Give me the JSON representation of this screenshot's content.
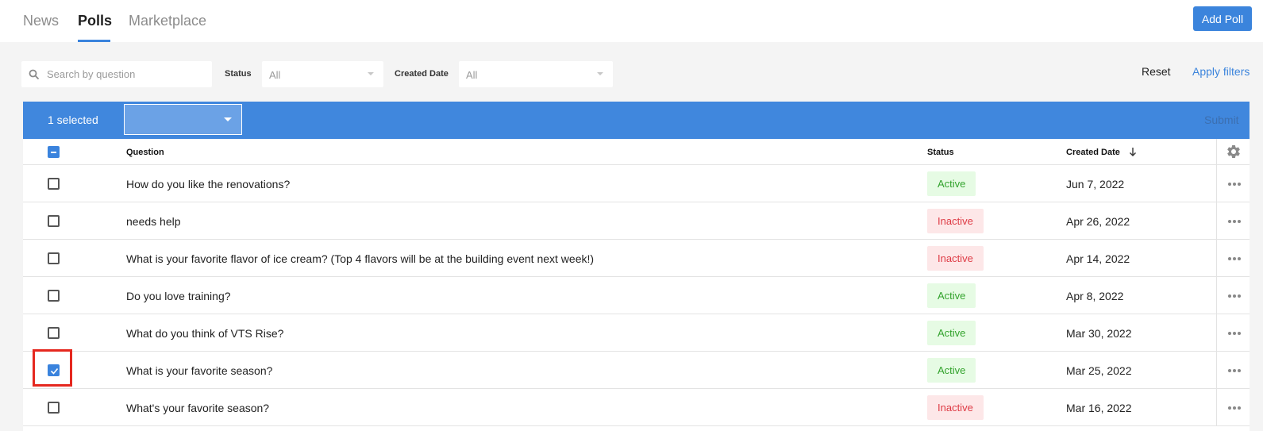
{
  "nav": {
    "tabs": [
      {
        "label": "News",
        "active": false
      },
      {
        "label": "Polls",
        "active": true
      },
      {
        "label": "Marketplace",
        "active": false
      }
    ],
    "add_button": "Add Poll"
  },
  "filters": {
    "search_placeholder": "Search by question",
    "status_label": "Status",
    "status_value": "All",
    "created_label": "Created Date",
    "created_value": "All",
    "reset": "Reset",
    "apply": "Apply filters"
  },
  "bulk": {
    "selected_text": "1 selected",
    "submit": "Submit"
  },
  "columns": {
    "question": "Question",
    "status": "Status",
    "created": "Created Date"
  },
  "rows": [
    {
      "question": "How do you like the renovations?",
      "status": "Active",
      "date": "Jun 7, 2022",
      "checked": false
    },
    {
      "question": "needs help",
      "status": "Inactive",
      "date": "Apr 26, 2022",
      "checked": false
    },
    {
      "question": "What is your favorite flavor of ice cream? (Top 4 flavors will be at the building event next week!)",
      "status": "Inactive",
      "date": "Apr 14, 2022",
      "checked": false
    },
    {
      "question": "Do you love training?",
      "status": "Active",
      "date": "Apr 8, 2022",
      "checked": false
    },
    {
      "question": "What do you think of VTS Rise?",
      "status": "Active",
      "date": "Mar 30, 2022",
      "checked": false
    },
    {
      "question": "What is your favorite season?",
      "status": "Active",
      "date": "Mar 25, 2022",
      "checked": true
    },
    {
      "question": "What's your favorite season?",
      "status": "Inactive",
      "date": "Mar 16, 2022",
      "checked": false
    }
  ],
  "colors": {
    "accent": "#3b84dc",
    "active_bg": "#e6fbe4",
    "active_text": "#33a32d",
    "inactive_bg": "#fde7e8",
    "inactive_text": "#de3b45",
    "highlight": "#e5281f"
  },
  "icons": [
    "search-icon",
    "gear-icon",
    "sort-down-arrow-icon",
    "more-dots-icon",
    "checkmark-icon",
    "caret-down-icon"
  ]
}
